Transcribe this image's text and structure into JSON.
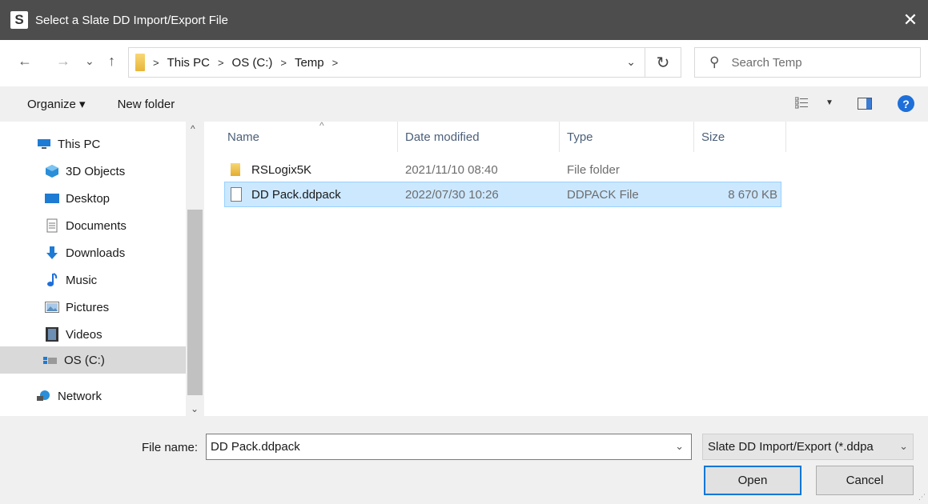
{
  "window": {
    "app_icon_letter": "S",
    "title": "Select a Slate DD Import/Export File",
    "close_glyph": "✕"
  },
  "navigation": {
    "back_glyph": "←",
    "forward_glyph": "→",
    "recent_glyph": "⌄",
    "up_glyph": "↑",
    "breadcrumb": [
      "This PC",
      "OS (C:)",
      "Temp"
    ],
    "refresh_glyph": "↻",
    "search_placeholder": "Search Temp"
  },
  "toolbar": {
    "organize_label": "Organize ▾",
    "new_folder_label": "New folder",
    "help_glyph": "?"
  },
  "sidebar": {
    "items": [
      {
        "label": "This PC",
        "icon": "computer-icon"
      },
      {
        "label": "3D Objects",
        "icon": "3d-objects-icon"
      },
      {
        "label": "Desktop",
        "icon": "desktop-icon"
      },
      {
        "label": "Documents",
        "icon": "documents-icon"
      },
      {
        "label": "Downloads",
        "icon": "downloads-icon"
      },
      {
        "label": "Music",
        "icon": "music-icon"
      },
      {
        "label": "Pictures",
        "icon": "pictures-icon"
      },
      {
        "label": "Videos",
        "icon": "videos-icon"
      },
      {
        "label": "OS (C:)",
        "icon": "drive-icon",
        "selected": true
      },
      {
        "label": "Network",
        "icon": "network-icon"
      }
    ]
  },
  "file_list": {
    "columns": [
      "Name",
      "Date modified",
      "Type",
      "Size"
    ],
    "rows": [
      {
        "name": "RSLogix5K",
        "date": "2021/11/10 08:40",
        "type": "File folder",
        "size": "",
        "icon": "folder-icon",
        "selected": false
      },
      {
        "name": "DD Pack.ddpack",
        "date": "2022/07/30 10:26",
        "type": "DDPACK File",
        "size": "8 670 KB",
        "icon": "file-icon",
        "selected": true
      }
    ]
  },
  "bottom": {
    "file_name_label": "File name:",
    "file_name_value": "DD Pack.ddpack",
    "filter_value": "Slate DD Import/Export (*.ddpa",
    "open_label": "Open",
    "cancel_label": "Cancel"
  },
  "colors": {
    "titlebar": "#4d4d4d",
    "selection": "#cce8ff",
    "accent": "#0078d7"
  }
}
